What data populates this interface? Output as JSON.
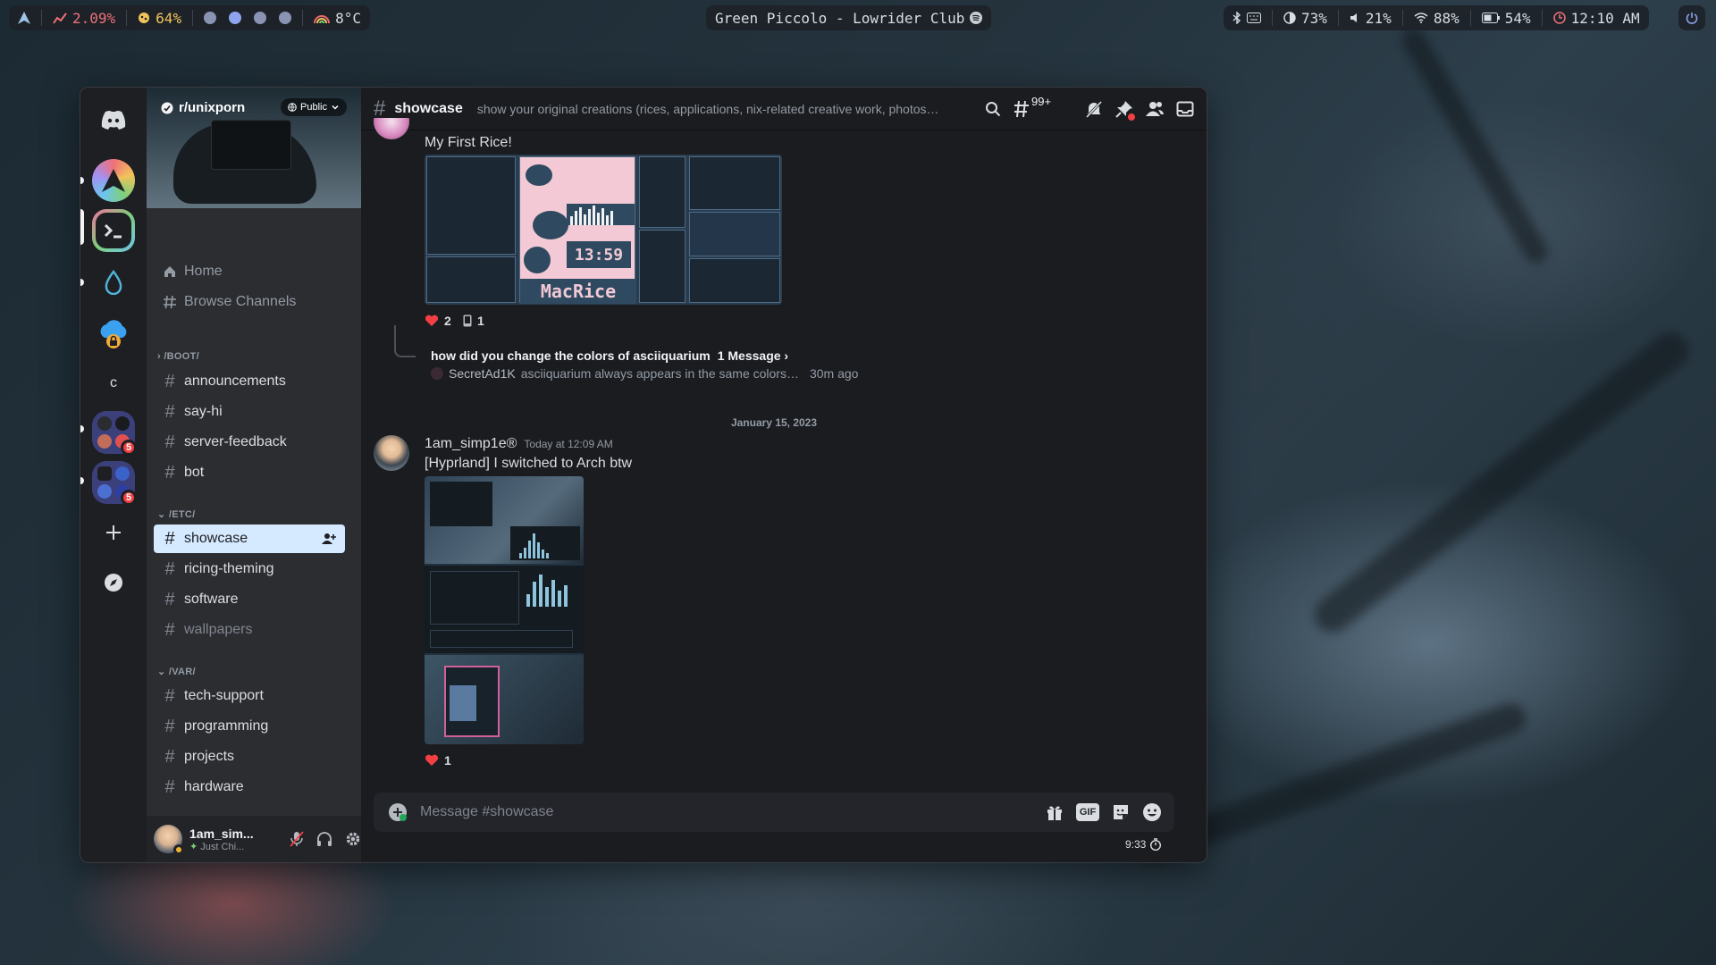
{
  "topbar": {
    "cpu": "2.09%",
    "memory": "64%",
    "weather": "8°C",
    "now_playing": "Green Piccolo - Lowrider Club",
    "brightness": "73%",
    "volume": "21%",
    "wifi": "88%",
    "battery": "54%",
    "clock": "12:10 AM"
  },
  "server": {
    "name": "r/unixporn",
    "visibility": "Public"
  },
  "nav": {
    "home": "Home",
    "browse": "Browse Channels"
  },
  "categories": [
    {
      "label": "/BOOT/",
      "channels": [
        "announcements",
        "say-hi",
        "server-feedback",
        "bot"
      ]
    },
    {
      "label": "/ETC/",
      "channels": [
        "showcase",
        "ricing-theming",
        "software",
        "wallpapers"
      ]
    },
    {
      "label": "/VAR/",
      "channels": [
        "tech-support",
        "programming",
        "projects",
        "hardware"
      ]
    }
  ],
  "user": {
    "name": "1am_sim...",
    "status": "Just Chi..."
  },
  "guild_labels": {
    "text_guild": "c",
    "badge_1": "5",
    "badge_2": "5"
  },
  "channel": {
    "name": "showcase",
    "topic": "show your original creations (rices, applications, nix-related creative work, photos…",
    "threads_count": "99+"
  },
  "messages": {
    "first": {
      "text": "My First Rice!",
      "image_caption_clock": "13:59",
      "image_caption_title": "MacRice",
      "reactions": [
        {
          "emoji": "heart",
          "count": "2"
        },
        {
          "emoji": "phone",
          "count": "1"
        }
      ],
      "thread": {
        "title": "how did you change the colors of asciiquarium",
        "count": "1 Message ›",
        "last_author": "SecretAd1K",
        "last_text": "asciiquarium always appears in the same colors…",
        "last_time": "30m ago"
      }
    },
    "divider": "January 15, 2023",
    "second": {
      "author": "1am_simp1e®",
      "time": "Today at 12:09 AM",
      "text": "[Hyprland] I switched to Arch btw",
      "reactions": [
        {
          "emoji": "heart",
          "count": "1"
        }
      ]
    }
  },
  "composer": {
    "placeholder": "Message #showcase",
    "gif_label": "GIF",
    "slowmode": "9:33"
  },
  "colors": {
    "accent_active_channel": "#d5e9ff",
    "danger": "#f23f43",
    "background_main": "#1a1c20"
  }
}
